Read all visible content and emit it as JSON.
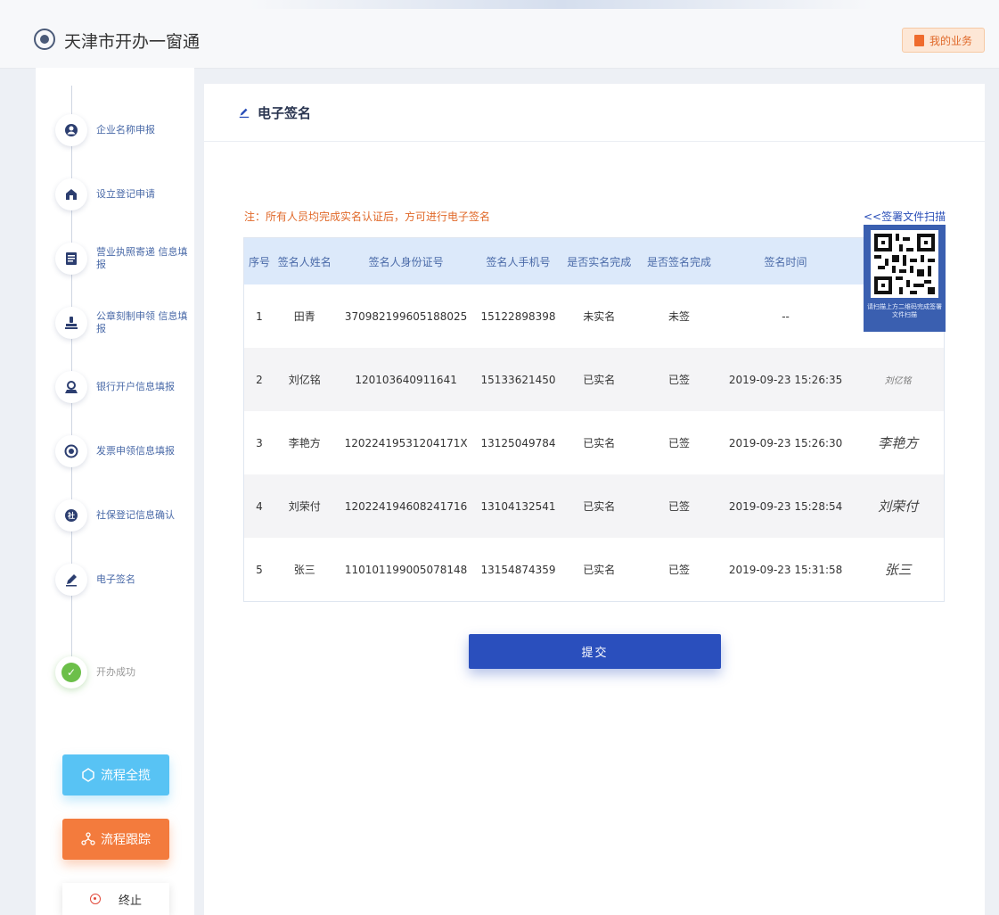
{
  "header": {
    "app_title": "天津市开办一窗通",
    "my_business_label": "我的业务"
  },
  "sidebar": {
    "steps": [
      {
        "label": "企业名称申报",
        "icon": "user-icon"
      },
      {
        "label": "设立登记申请",
        "icon": "home-icon"
      },
      {
        "label": "营业执照寄递 信息填报",
        "icon": "clipboard-icon"
      },
      {
        "label": "公章刻制申领 信息填报",
        "icon": "stamp-icon"
      },
      {
        "label": "银行开户信息填报",
        "icon": "bank-user-icon"
      },
      {
        "label": "发票申领信息填报",
        "icon": "invoice-icon"
      },
      {
        "label": "社保登记信息确认",
        "icon": "social-security-icon"
      },
      {
        "label": "电子签名",
        "icon": "pen-icon"
      },
      {
        "label": "开办成功",
        "icon": "check-icon"
      }
    ],
    "buttons": {
      "overview": "流程全揽",
      "track": "流程跟踪",
      "stop": "终止"
    }
  },
  "main": {
    "title": "电子签名",
    "note": "注：所有人员均完成实名认证后，方可进行电子签名",
    "scan_link": "<<签署文件扫描",
    "qr_caption": "请扫描上方二维码完成签署文件扫描",
    "table": {
      "headers": [
        "序号",
        "签名人姓名",
        "签名人身份证号",
        "签名人手机号",
        "是否实名完成",
        "是否签名完成",
        "签名时间",
        ""
      ],
      "rows": [
        [
          "1",
          "田青",
          "370982199605188025",
          "15122898398",
          "未实名",
          "未签",
          "--",
          ""
        ],
        [
          "2",
          "刘亿铭",
          "120103640911641",
          "15133621450",
          "已实名",
          "已签",
          "2019-09-23 15:26:35",
          "刘亿铭"
        ],
        [
          "3",
          "李艳方",
          "12022419531204171X",
          "13125049784",
          "已实名",
          "已签",
          "2019-09-23 15:26:30",
          "李艳方"
        ],
        [
          "4",
          "刘荣付",
          "120224194608241716",
          "13104132541",
          "已实名",
          "已签",
          "2019-09-23 15:28:54",
          "刘荣付"
        ],
        [
          "5",
          "张三",
          "110101199005078148",
          "13154874359",
          "已实名",
          "已签",
          "2019-09-23 15:31:58",
          "张三"
        ]
      ]
    },
    "submit_label": "提交"
  },
  "colors": {
    "accent": "#2a4fbd",
    "note": "#e0692a",
    "header_row": "#dce9fa",
    "overview_button": "#58c3f4",
    "track_button": "#f37b3d"
  }
}
